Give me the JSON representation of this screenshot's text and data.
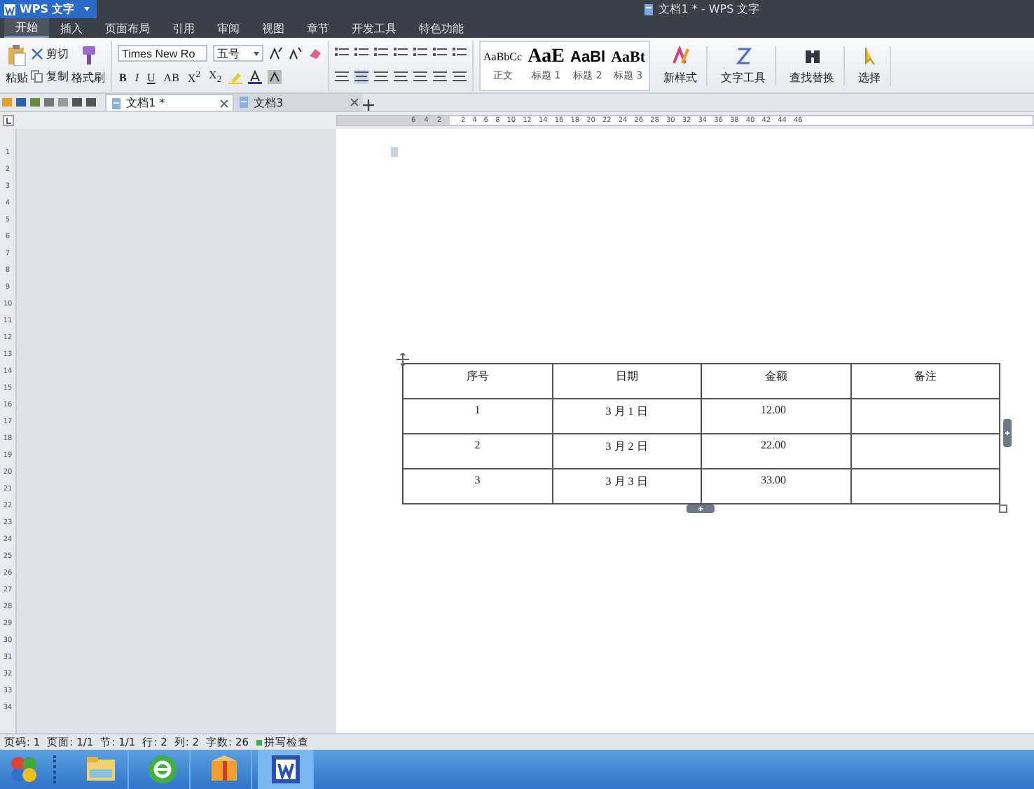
{
  "app_button": {
    "label": "WPS 文字"
  },
  "window": {
    "title": "文档1 * - WPS 文字"
  },
  "menu_tabs": [
    {
      "label": "开始",
      "selected": true
    },
    {
      "label": "插入",
      "selected": false
    },
    {
      "label": "页面布局",
      "selected": false
    },
    {
      "label": "引用",
      "selected": false
    },
    {
      "label": "审阅",
      "selected": false
    },
    {
      "label": "视图",
      "selected": false
    },
    {
      "label": "章节",
      "selected": false
    },
    {
      "label": "开发工具",
      "selected": false
    },
    {
      "label": "特色功能",
      "selected": false
    }
  ],
  "ribbon": {
    "clipboard": {
      "paste": "粘贴",
      "cut": "剪切",
      "copy": "复制",
      "format_painter": "格式刷"
    },
    "font": {
      "name": "Times New Ro",
      "size": "五号",
      "buttons": [
        "B",
        "I",
        "U",
        "AB",
        "X$^{2}$",
        "X$_{2}$"
      ]
    },
    "styles": [
      {
        "preview": "AaBbCc",
        "label": "正文",
        "kind": "body"
      },
      {
        "preview": "AaE",
        "label": "标题 1",
        "kind": "h1"
      },
      {
        "preview": "AaBl",
        "label": "标题 2",
        "kind": "h2"
      },
      {
        "preview": "AaBt",
        "label": "标题 3",
        "kind": "h3"
      }
    ],
    "commands": [
      "新样式",
      "文字工具",
      "查找替换",
      "选择"
    ]
  },
  "doc_tabs": [
    {
      "label": "文档1 *",
      "selected": true
    },
    {
      "label": "文档3",
      "selected": false
    }
  ],
  "ruler": {
    "left_labels": [
      "6",
      "4",
      "2"
    ],
    "right_labels": [
      "2",
      "4",
      "6",
      "8",
      "10",
      "12",
      "14",
      "16",
      "18",
      "20",
      "22",
      "24",
      "26",
      "28",
      "30",
      "32",
      "34",
      "36",
      "38",
      "40",
      "42",
      "44",
      "46"
    ]
  },
  "vertical_ruler": {
    "labels": [
      "1",
      "2",
      "3",
      "4",
      "5",
      "6",
      "7",
      "8",
      "9",
      "10",
      "11",
      "12",
      "13",
      "14",
      "15",
      "16",
      "17",
      "18",
      "19",
      "20",
      "21",
      "22",
      "23",
      "24",
      "25",
      "26",
      "27",
      "28",
      "29",
      "30",
      "31",
      "32",
      "33",
      "34"
    ]
  },
  "table": {
    "columns": [
      "序号",
      "日期",
      "金额",
      "备注"
    ],
    "rows": [
      [
        "1",
        "3 月 1 日",
        "12.00"
      ],
      [
        "2",
        "3 月 2 日",
        "22.00"
      ],
      [
        "3",
        "3 月 3 日",
        "33.00"
      ]
    ]
  },
  "status_bar": {
    "items": [
      "页码: 1",
      "页面: 1/1",
      "节: 1/1",
      "行: 2",
      "列: 2",
      "字数: 26"
    ],
    "spell_check": {
      "label": "拼写检查",
      "on": true
    }
  }
}
